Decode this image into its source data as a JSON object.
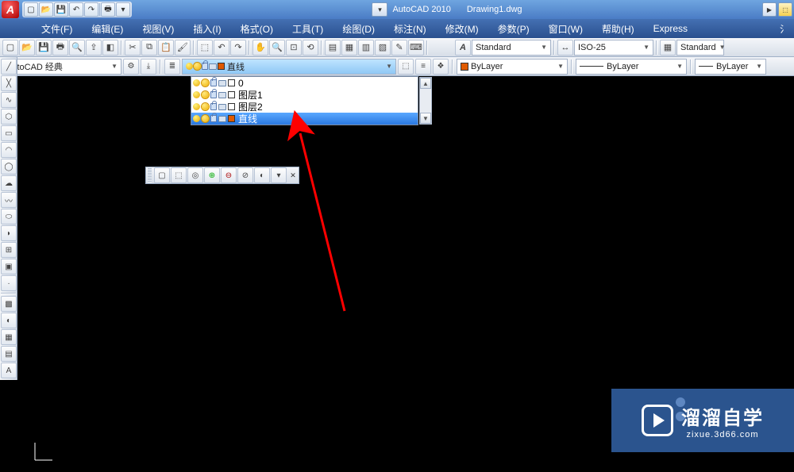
{
  "title": {
    "app": "AutoCAD 2010",
    "doc": "Drawing1.dwg"
  },
  "menu": [
    "文件(F)",
    "编辑(E)",
    "视图(V)",
    "插入(I)",
    "格式(O)",
    "工具(T)",
    "绘图(D)",
    "标注(N)",
    "修改(M)",
    "参数(P)",
    "窗口(W)",
    "帮助(H)",
    "Express"
  ],
  "toolbar1": {
    "textStyle": "Standard",
    "dimStyle": "ISO-25",
    "tableStyle": "Standard"
  },
  "toolbar2": {
    "workspace": "AutoCAD 经典",
    "layerCurrent": "直线",
    "layerCurrentColor": "#e05a00",
    "colorCtl": "ByLayer",
    "colorSwatch": "#e05a00",
    "linetypeCtl": "ByLayer",
    "lineweightCtl": "ByLayer"
  },
  "layerList": [
    {
      "name": "0",
      "color": "#ffffff",
      "selected": false
    },
    {
      "name": "图层1",
      "color": "#ffffff",
      "selected": false
    },
    {
      "name": "图层2",
      "color": "#ffffff",
      "selected": false
    },
    {
      "name": "直线",
      "color": "#e05a00",
      "selected": true
    }
  ],
  "watermark": {
    "brand": "溜溜自学",
    "url": "zixue.3d66.com"
  }
}
